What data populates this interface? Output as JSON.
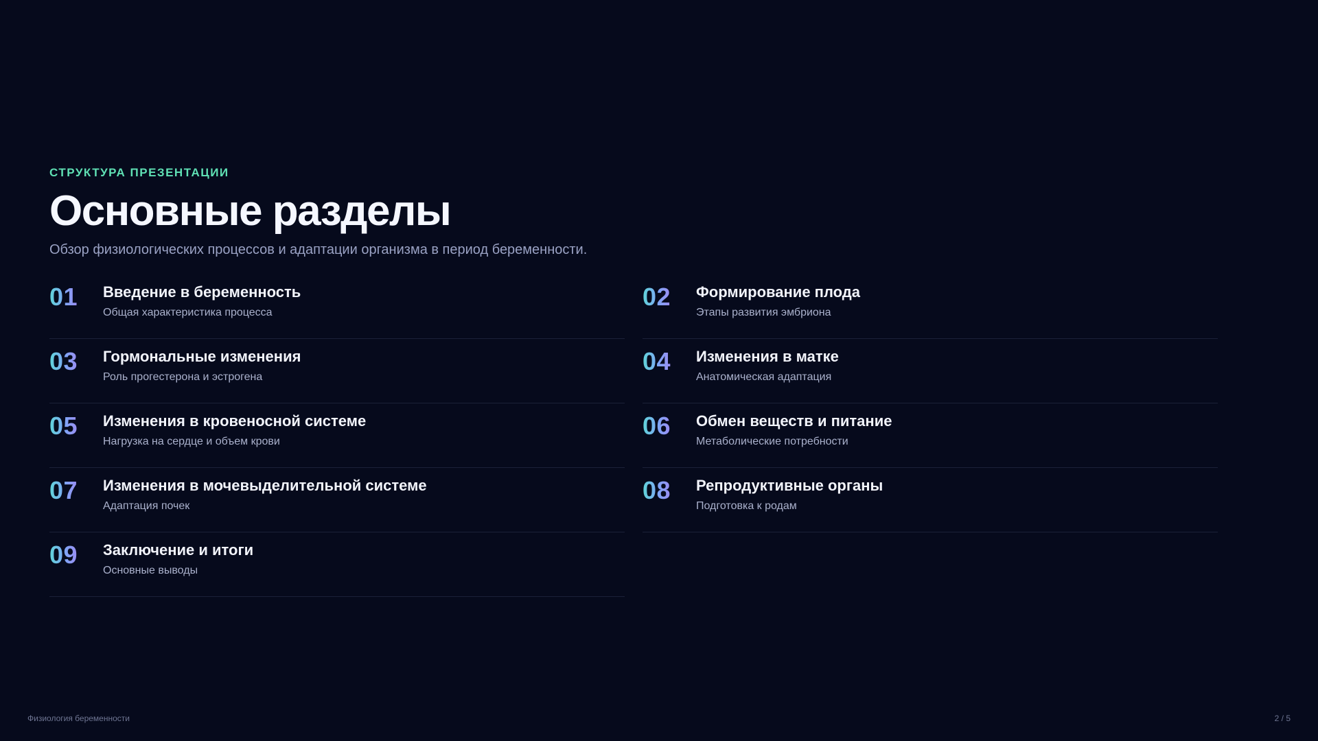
{
  "header": {
    "eyebrow": "СТРУКТУРА ПРЕЗЕНТАЦИИ",
    "title": "Основные разделы",
    "subtitle": "Обзор физиологических процессов и адаптации организма в период беременности."
  },
  "sections": [
    {
      "number": "01",
      "title": "Введение в беременность",
      "description": "Общая характеристика процесса"
    },
    {
      "number": "02",
      "title": "Формирование плода",
      "description": "Этапы развития эмбриона"
    },
    {
      "number": "03",
      "title": "Гормональные изменения",
      "description": "Роль прогестерона и эстрогена"
    },
    {
      "number": "04",
      "title": "Изменения в матке",
      "description": "Анатомическая адаптация"
    },
    {
      "number": "05",
      "title": "Изменения в кровеносной системе",
      "description": "Нагрузка на сердце и объем крови"
    },
    {
      "number": "06",
      "title": "Обмен веществ и питание",
      "description": "Метаболические потребности"
    },
    {
      "number": "07",
      "title": "Изменения в мочевыделительной системе",
      "description": "Адаптация почек"
    },
    {
      "number": "08",
      "title": "Репродуктивные органы",
      "description": "Подготовка к родам"
    },
    {
      "number": "09",
      "title": "Заключение и итоги",
      "description": "Основные выводы"
    }
  ],
  "footer": {
    "deck_title": "Физиология беременности",
    "page_indicator": "2 / 5"
  },
  "colors": {
    "background": "#060a1c",
    "eyebrow_accent": "#5fe0b4",
    "number_gradient_start": "#5fd6d8",
    "number_gradient_end": "#9b8cf2",
    "divider": "#1b2138"
  }
}
